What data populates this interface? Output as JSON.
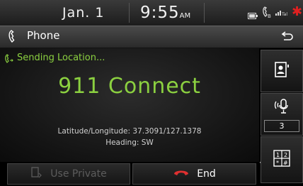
{
  "status_bar": {
    "date": "Jan.  1",
    "time": "9:55",
    "ampm": "AM",
    "icons": [
      "battery-icon",
      "bluetooth-phone-icon",
      "signal-icon",
      "asterisk-icon"
    ]
  },
  "title_bar": {
    "title": "Phone",
    "back_icon": "back-icon"
  },
  "call": {
    "status_text": "Sending Location...",
    "title": "911 Connect",
    "latlon_text": "Latitude/Longitude: 37.3091/127.1378",
    "heading_text": "Heading: SW"
  },
  "side_panel": {
    "mic_level": "3"
  },
  "buttons": {
    "use_private": "Use Private",
    "end": "End"
  },
  "colors": {
    "accent_green": "#8bd040",
    "end_red": "#e03030",
    "status_red": "#e02020"
  }
}
